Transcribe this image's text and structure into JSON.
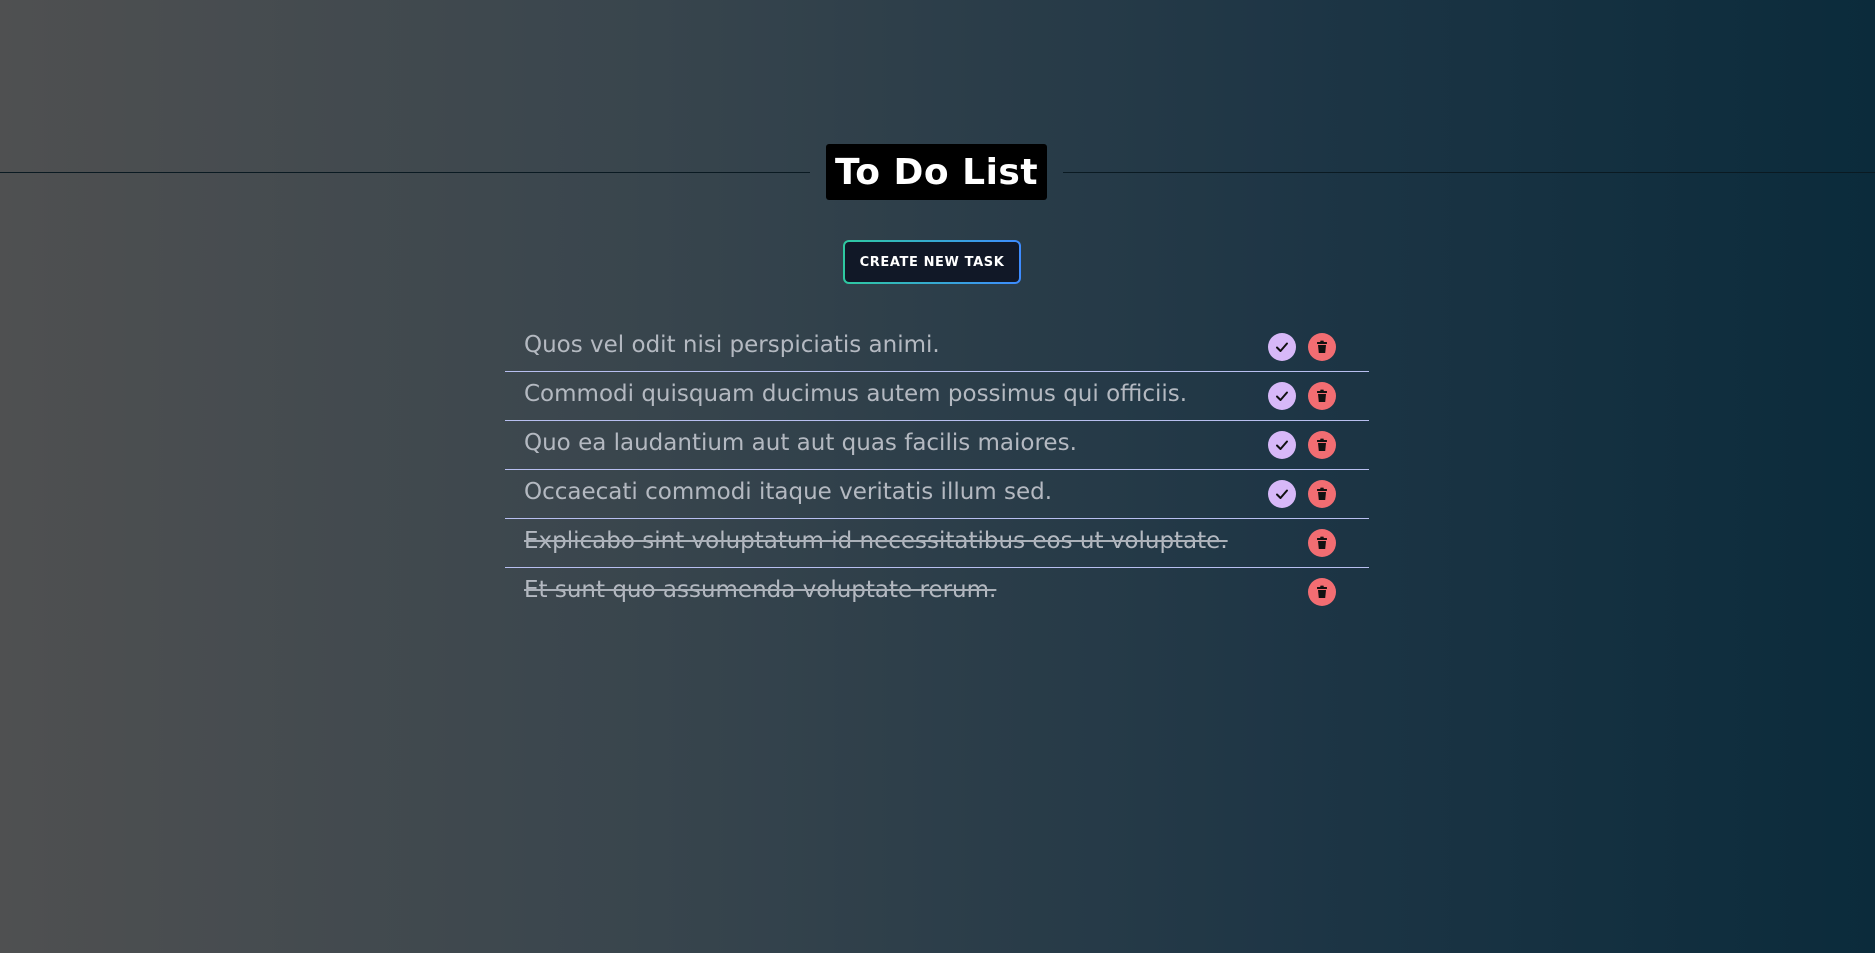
{
  "header": {
    "title": "To Do List"
  },
  "toolbar": {
    "create_label": "CREATE NEW TASK"
  },
  "tasks": [
    {
      "text": "Quos vel odit nisi perspiciatis animi.",
      "completed": false
    },
    {
      "text": "Commodi quisquam ducimus autem possimus qui officiis.",
      "completed": false
    },
    {
      "text": "Quo ea laudantium aut aut quas facilis maiores.",
      "completed": false
    },
    {
      "text": "Occaecati commodi itaque veritatis illum sed.",
      "completed": false
    },
    {
      "text": "Explicabo sint voluptatum id necessitatibus eos ut voluptate.",
      "completed": true
    },
    {
      "text": "Et sunt quo assumenda voluptate rerum.",
      "completed": true
    }
  ],
  "icons": {
    "complete": "check-icon",
    "delete": "trash-icon"
  },
  "colors": {
    "check_button": "#d7b8f8",
    "delete_button": "#f26d72",
    "title_background": "#000000",
    "button_border_start": "#2ec9a0",
    "button_border_end": "#3d8bff"
  }
}
